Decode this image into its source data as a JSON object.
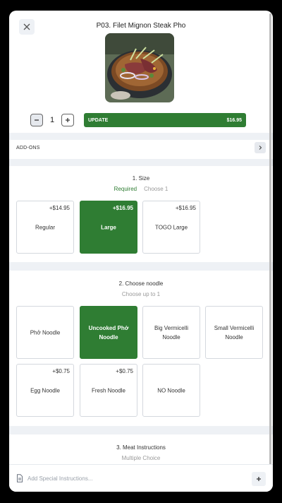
{
  "item": {
    "title": "P03. Filet Mignon Steak Pho",
    "quantity": "1",
    "update_label": "UPDATE",
    "update_price": "$16.95"
  },
  "addons": {
    "label": "ADD-ONS"
  },
  "size": {
    "title": "1. Size",
    "required_label": "Required",
    "choose_label": "Choose 1",
    "options": [
      {
        "name": "Regular",
        "price": "+$14.95",
        "selected": false
      },
      {
        "name": "Large",
        "price": "+$16.95",
        "selected": true
      },
      {
        "name": "TOGO Large",
        "price": "+$16.95",
        "selected": false
      }
    ]
  },
  "noodle": {
    "title": "2. Choose noodle",
    "choose_label": "Choose up to 1",
    "options": [
      {
        "name": "Phở Noodle",
        "price": "",
        "selected": false
      },
      {
        "name": "Uncooked Phở Noodle",
        "price": "",
        "selected": true
      },
      {
        "name": "Big Vermicelli Noodle",
        "price": "",
        "selected": false
      },
      {
        "name": "Small Vermicelli Noodle",
        "price": "",
        "selected": false
      },
      {
        "name": "Egg Noodle",
        "price": "+$0.75",
        "selected": false
      },
      {
        "name": "Fresh Noodle",
        "price": "+$0.75",
        "selected": false
      },
      {
        "name": "NO Noodle",
        "price": "",
        "selected": false
      }
    ]
  },
  "meat": {
    "title": "3. Meat Instructions",
    "choose_label": "Multiple Choice"
  },
  "special": {
    "placeholder": "Add Special Instructions..."
  },
  "colors": {
    "accent": "#2f7d33",
    "band": "#eef1f5"
  }
}
